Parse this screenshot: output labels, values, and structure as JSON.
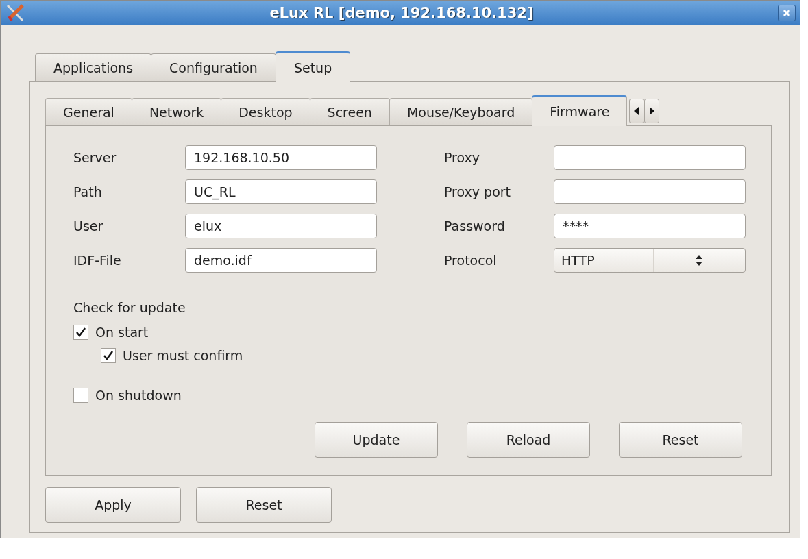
{
  "window": {
    "title": "eLux RL [demo, 192.168.10.132]"
  },
  "tabs": [
    {
      "label": "Applications",
      "selected": false
    },
    {
      "label": "Configuration",
      "selected": false
    },
    {
      "label": "Setup",
      "selected": true
    }
  ],
  "subtabs": [
    {
      "label": "General",
      "selected": false
    },
    {
      "label": "Network",
      "selected": false
    },
    {
      "label": "Desktop",
      "selected": false
    },
    {
      "label": "Screen",
      "selected": false
    },
    {
      "label": "Mouse/Keyboard",
      "selected": false
    },
    {
      "label": "Firmware",
      "selected": true
    }
  ],
  "fields_left": [
    {
      "label": "Server",
      "value": "192.168.10.50",
      "kind": "text"
    },
    {
      "label": "Path",
      "value": "UC_RL",
      "kind": "text"
    },
    {
      "label": "User",
      "value": "elux",
      "kind": "text"
    },
    {
      "label": "IDF-File",
      "value": "demo.idf",
      "kind": "text"
    }
  ],
  "fields_right": [
    {
      "label": "Proxy",
      "kind": "text"
    },
    {
      "label": "Proxy port",
      "kind": "text"
    },
    {
      "label": "Password",
      "value": "****",
      "kind": "text"
    },
    {
      "label": "Protocol",
      "value": "HTTP",
      "kind": "select"
    }
  ],
  "update_heading": "Check for update",
  "checks": [
    {
      "label": "On start",
      "checked": true,
      "kind": "top"
    },
    {
      "label": "User must confirm",
      "checked": true,
      "kind": "nested"
    },
    {
      "label": "On shutdown",
      "checked": false,
      "kind": "top"
    }
  ],
  "panel_buttons": [
    "Update",
    "Reload",
    "Reset"
  ],
  "buttons": [
    "Apply",
    "Reset"
  ]
}
